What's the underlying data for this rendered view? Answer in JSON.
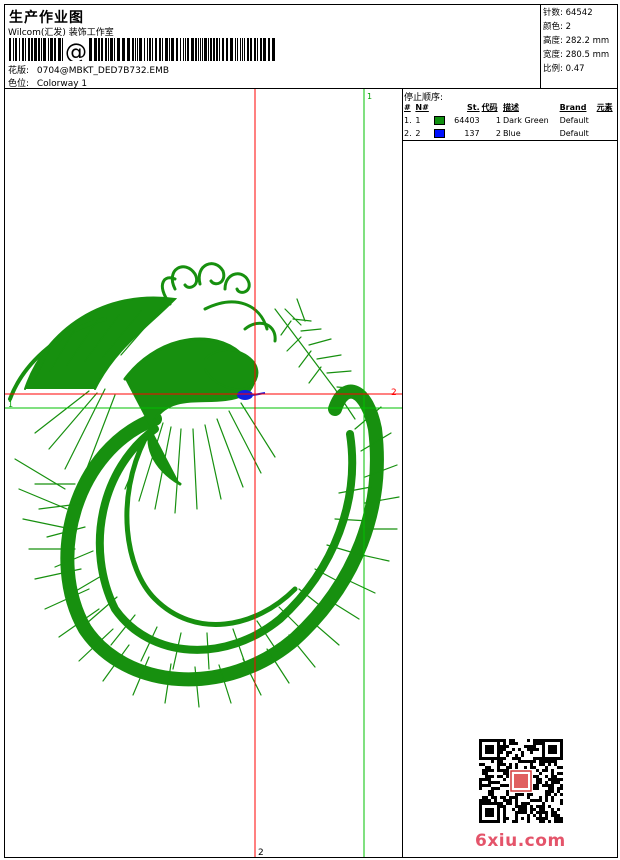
{
  "header": {
    "title": "生产作业图",
    "company": "Wilcom(汇发) 装饰工作室",
    "design_label": "花版:",
    "design_file": "0704@MBKT_DED7B732.EMB",
    "colorway_label": "色位:",
    "colorway": "Colorway 1"
  },
  "stats": {
    "stitches_label": "针数:",
    "stitches": "64542",
    "colors_label": "颜色:",
    "colors": "2",
    "height_label": "高度:",
    "height": "282.2 mm",
    "width_label": "宽度:",
    "width": "280.5 mm",
    "scale_label": "比例:",
    "scale": "0.47"
  },
  "canvas": {
    "marker_h1": "1",
    "marker_v1": "1",
    "marker_h2": "2",
    "marker_v2": "2",
    "colors": {
      "guide_green": "#00c000",
      "guide_red": "#ff0000",
      "thread_green": "#17900f",
      "thread_blue": "#1020e0"
    }
  },
  "sequence": {
    "title": "停止顺序:",
    "headers": [
      "#",
      "N#",
      "",
      "St.",
      "代码",
      "描述",
      "Brand",
      "元素"
    ],
    "rows": [
      {
        "index": "1.",
        "n": "1",
        "color": "#109010",
        "stitches": "64403",
        "code": "1",
        "desc": "Dark Green",
        "brand": "Default"
      },
      {
        "index": "2.",
        "n": "2",
        "color": "#0010ff",
        "stitches": "137",
        "code": "2",
        "desc": "Blue",
        "brand": "Default"
      }
    ]
  },
  "watermark": "6xiu.com",
  "icons": {
    "qr": "qr-code-icon",
    "barcode": "barcode-icon"
  }
}
